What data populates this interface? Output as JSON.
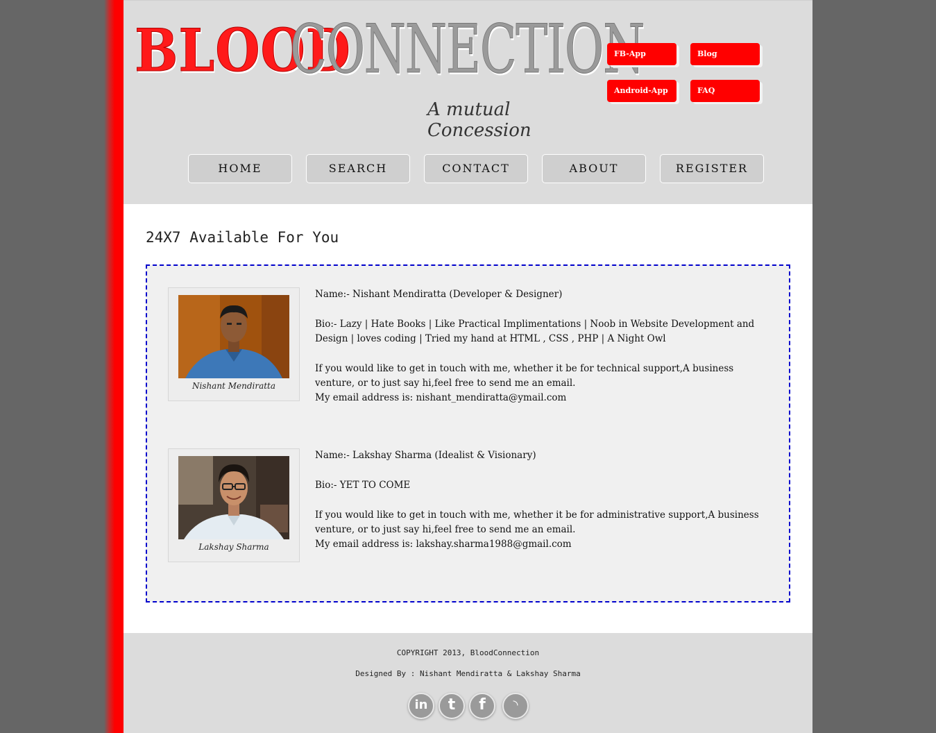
{
  "logo": {
    "part1": "BLOOD",
    "part2": "CONNECTION",
    "tagline": "A mutual Concession"
  },
  "quick_links": [
    "FB-App",
    "Blog",
    "Android-App",
    "FAQ"
  ],
  "nav": [
    "HOME",
    "SEARCH",
    "CONTACT",
    "ABOUT",
    "REGISTER"
  ],
  "heading": "24X7 Available For You",
  "members": [
    {
      "caption": "Nishant Mendiratta",
      "name": "Name:- Nishant Mendiratta (Developer & Designer)",
      "bio": "Bio:- Lazy | Hate Books | Like Practical Implimentations | Noob in Website Development and Design | loves coding | Tried my hand at HTML , CSS , PHP | A Night Owl",
      "contact": "If you would like to get in touch with me, whether it be for technical support,A business venture, or to just say hi,feel free to send me an email.",
      "email": "My email address is: nishant_mendiratta@ymail.com"
    },
    {
      "caption": "Lakshay Sharma",
      "name": "Name:- Lakshay Sharma (Idealist & Visionary)",
      "bio": "Bio:- YET TO COME",
      "contact": "If you would like to get in touch with me, whether it be for administrative support,A business venture, or to just say hi,feel free to send me an email.",
      "email": "My email address is: lakshay.sharma1988@gmail.com"
    }
  ],
  "footer": {
    "copyright": "COPYRIGHT 2013, BloodConnection",
    "designed": "Designed By : Nishant Mendiratta & Lakshay Sharma"
  },
  "social": [
    {
      "icon": "linkedin-icon",
      "glyph": "in"
    },
    {
      "icon": "tumblr-icon",
      "glyph": "t"
    },
    {
      "icon": "facebook-icon",
      "glyph": "f"
    },
    {
      "icon": "rss-icon",
      "glyph": "◝"
    }
  ],
  "colors": {
    "brand_red": "#ff0000",
    "header_bg": "#dcdcdc",
    "dashed_border": "#0000cc"
  }
}
